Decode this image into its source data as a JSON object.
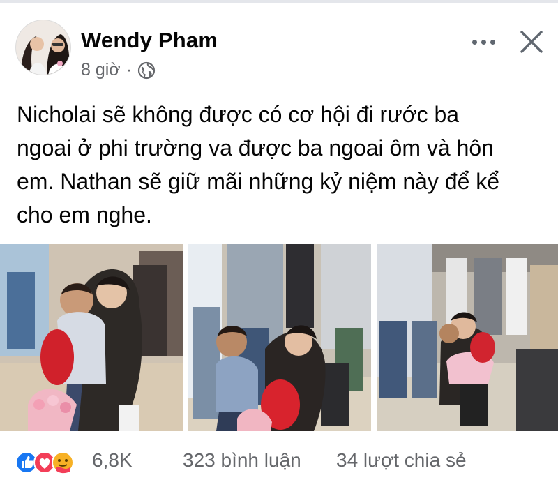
{
  "post": {
    "author": "Wendy Pham",
    "time": "8 giờ",
    "separator": "·",
    "privacy_icon": "globe-icon",
    "lines": [
      "Nicholai sẽ không được có cơ hội đi rước ba",
      "ngoai ở phi trường va được ba ngoai ôm và hôn",
      "em. Nathan sẽ giữ mãi những kỷ niệm này để kể",
      "cho em nghe."
    ]
  },
  "header": {
    "more_icon": "more-options-icon",
    "close_icon": "close-icon"
  },
  "photos": [
    "photo-hug",
    "photo-kneeling",
    "photo-arrival-crowd"
  ],
  "footer": {
    "reaction_icons": [
      "like-icon",
      "love-icon",
      "care-icon"
    ],
    "reaction_count": "6,8K",
    "comments": "323 bình luận",
    "shares": "34 lượt chia sẻ"
  },
  "colors": {
    "like": "#1877f2",
    "love": "#f33e58",
    "care": "#f7b125",
    "secondary_text": "#65676b"
  }
}
